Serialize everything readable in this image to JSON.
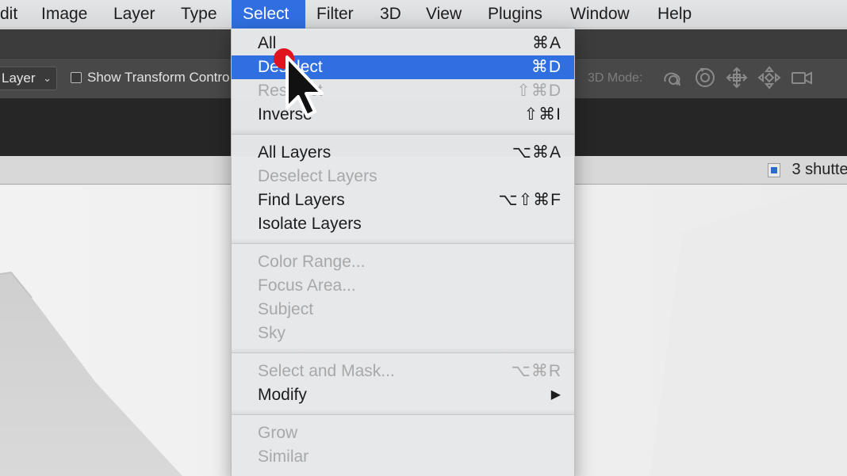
{
  "menubar": {
    "items": [
      {
        "label": "dit",
        "active": false
      },
      {
        "label": "Image",
        "active": false
      },
      {
        "label": "Layer",
        "active": false
      },
      {
        "label": "Type",
        "active": false
      },
      {
        "label": "Select",
        "active": true
      },
      {
        "label": "Filter",
        "active": false
      },
      {
        "label": "3D",
        "active": false
      },
      {
        "label": "View",
        "active": false
      },
      {
        "label": "Plugins",
        "active": false
      },
      {
        "label": "Window",
        "active": false
      },
      {
        "label": "Help",
        "active": false
      }
    ]
  },
  "options_bar": {
    "auto_select_value": "Layer",
    "show_transform_label": "Show Transform Contro",
    "show_transform_checked": false,
    "mode_label": "3D Mode:",
    "mode_icons": [
      "orbit-3d-icon",
      "roll-3d-icon",
      "pan-3d-icon",
      "slide-3d-icon",
      "camera-scale-3d-icon"
    ]
  },
  "document_tab": {
    "title": "3 shutte",
    "icon": "ps-document-icon"
  },
  "select_menu": {
    "groups": [
      [
        {
          "label": "All",
          "shortcut": "⌘A",
          "disabled": false,
          "highlighted": false
        },
        {
          "label": "Deselect",
          "shortcut": "⌘D",
          "disabled": false,
          "highlighted": true
        },
        {
          "label": "Reselect",
          "shortcut": "⇧⌘D",
          "disabled": true,
          "highlighted": false
        },
        {
          "label": "Inverse",
          "shortcut": "⇧⌘I",
          "disabled": false,
          "highlighted": false
        }
      ],
      [
        {
          "label": "All Layers",
          "shortcut": "⌥⌘A",
          "disabled": false,
          "highlighted": false
        },
        {
          "label": "Deselect Layers",
          "shortcut": "",
          "disabled": true,
          "highlighted": false
        },
        {
          "label": "Find Layers",
          "shortcut": "⌥⇧⌘F",
          "disabled": false,
          "highlighted": false
        },
        {
          "label": "Isolate Layers",
          "shortcut": "",
          "disabled": false,
          "highlighted": false
        }
      ],
      [
        {
          "label": "Color Range...",
          "shortcut": "",
          "disabled": true,
          "highlighted": false
        },
        {
          "label": "Focus Area...",
          "shortcut": "",
          "disabled": true,
          "highlighted": false
        },
        {
          "label": "Subject",
          "shortcut": "",
          "disabled": true,
          "highlighted": false
        },
        {
          "label": "Sky",
          "shortcut": "",
          "disabled": true,
          "highlighted": false
        }
      ],
      [
        {
          "label": "Select and Mask...",
          "shortcut": "⌥⌘R",
          "disabled": true,
          "highlighted": false
        },
        {
          "label": "Modify",
          "shortcut": "▶",
          "disabled": false,
          "highlighted": false
        }
      ],
      [
        {
          "label": "Grow",
          "shortcut": "",
          "disabled": true,
          "highlighted": false
        },
        {
          "label": "Similar",
          "shortcut": "",
          "disabled": true,
          "highlighted": false
        }
      ]
    ]
  },
  "colors": {
    "highlight": "#2f6fe0",
    "disabled_text": "#a8a8a8",
    "cursor_click_dot": "#e0141e"
  }
}
